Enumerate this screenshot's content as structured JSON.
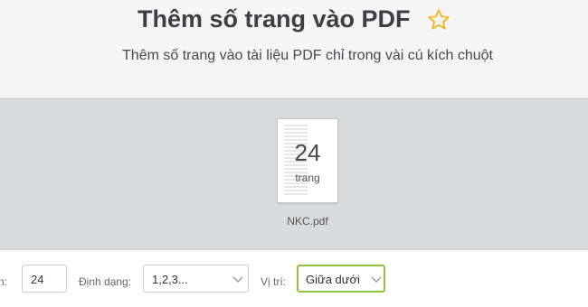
{
  "header": {
    "title": "Thêm số trang vào PDF",
    "subtitle": "Thêm số trang vào tài liệu PDF chỉ trong vài cú kích chuột"
  },
  "file": {
    "page_count": "24",
    "page_unit": "trang",
    "name": "NKC.pdf"
  },
  "options": {
    "start_label": "n:",
    "start_value": "24",
    "format_label": "Định dạng:",
    "format_value": "1,2,3...",
    "position_label": "Vị trí:",
    "position_value": "Giữa dưới"
  },
  "colors": {
    "star": "#f2b51b",
    "active_border": "#8cc63f"
  },
  "icons": {
    "favorite": "star-icon",
    "dropdown": "chevron-down-icon"
  }
}
